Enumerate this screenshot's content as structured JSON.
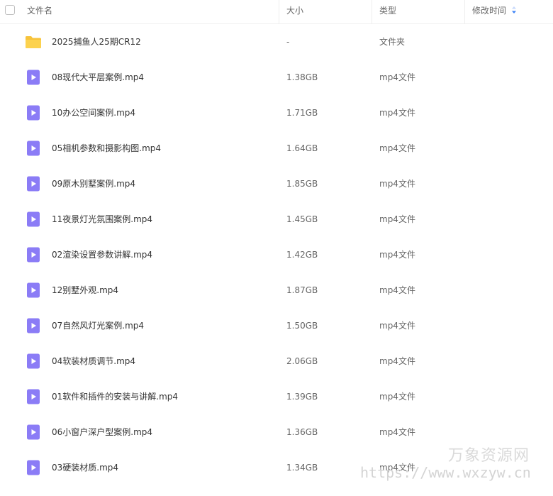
{
  "header": {
    "col_name": "文件名",
    "col_size": "大小",
    "col_type": "类型",
    "col_modified": "修改时间",
    "sort_color": "#3b82f6"
  },
  "rows": [
    {
      "icon": "folder-icon",
      "name": "2025捕鱼人25期CR12",
      "size": "-",
      "type": "文件夹"
    },
    {
      "icon": "video-file-icon",
      "name": "08现代大平层案例.mp4",
      "size": "1.38GB",
      "type": "mp4文件"
    },
    {
      "icon": "video-file-icon",
      "name": "10办公空间案例.mp4",
      "size": "1.71GB",
      "type": "mp4文件"
    },
    {
      "icon": "video-file-icon",
      "name": "05相机参数和摄影构图.mp4",
      "size": "1.64GB",
      "type": "mp4文件"
    },
    {
      "icon": "video-file-icon",
      "name": "09原木别墅案例.mp4",
      "size": "1.85GB",
      "type": "mp4文件"
    },
    {
      "icon": "video-file-icon",
      "name": "11夜景灯光氛围案例.mp4",
      "size": "1.45GB",
      "type": "mp4文件"
    },
    {
      "icon": "video-file-icon",
      "name": "02渲染设置参数讲解.mp4",
      "size": "1.42GB",
      "type": "mp4文件"
    },
    {
      "icon": "video-file-icon",
      "name": "12别墅外观.mp4",
      "size": "1.87GB",
      "type": "mp4文件"
    },
    {
      "icon": "video-file-icon",
      "name": "07自然风灯光案例.mp4",
      "size": "1.50GB",
      "type": "mp4文件"
    },
    {
      "icon": "video-file-icon",
      "name": "04软装材质调节.mp4",
      "size": "2.06GB",
      "type": "mp4文件"
    },
    {
      "icon": "video-file-icon",
      "name": "01软件和插件的安装与讲解.mp4",
      "size": "1.39GB",
      "type": "mp4文件"
    },
    {
      "icon": "video-file-icon",
      "name": "06小窗户深户型案例.mp4",
      "size": "1.36GB",
      "type": "mp4文件"
    },
    {
      "icon": "video-file-icon",
      "name": "03硬装材质.mp4",
      "size": "1.34GB",
      "type": "mp4文件"
    }
  ],
  "colors": {
    "folder": "#f7c33b",
    "video": "#8b7cf6"
  },
  "watermark": {
    "line1": "万象资源网",
    "line2": "https://www.wxzyw.cn"
  }
}
